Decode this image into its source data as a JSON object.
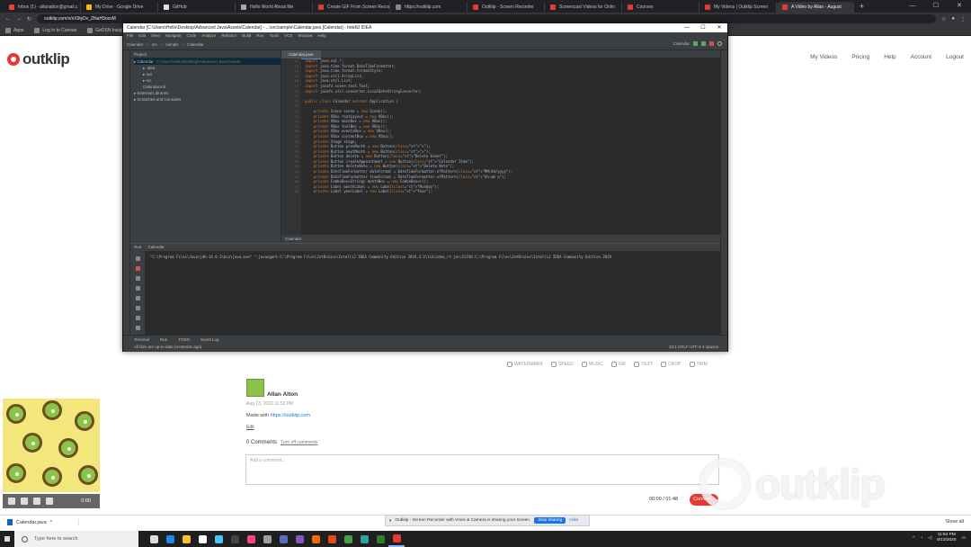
{
  "browser": {
    "tabs": [
      {
        "title": "Inbox (1) - allanalton@gmail.c",
        "color": "#ea4335"
      },
      {
        "title": "My Drive - Google Drive",
        "color": "#fbbc04"
      },
      {
        "title": "GitHub",
        "color": "#e0e0e0"
      },
      {
        "title": "Hello World About Me",
        "color": "#aaaaaa"
      },
      {
        "title": "Create GIF From Screen Recor",
        "color": "#e53935"
      },
      {
        "title": "https://outklip.com",
        "color": "#888888"
      },
      {
        "title": "Outklip - Screen Recorder",
        "color": "#e53935"
      },
      {
        "title": "Screencast Videos for Onlin",
        "color": "#e53935"
      },
      {
        "title": "Courses",
        "color": "#e53935"
      },
      {
        "title": "My Videos | Outklip Screen",
        "color": "#e53935"
      },
      {
        "title": "A Video by Allan - August",
        "color": "#e53935",
        "active": true
      }
    ],
    "new_tab": "+",
    "window_controls": [
      "—",
      "☐",
      "✕"
    ],
    "url": "outklip.com/v/nX9iyDv_ZNaH3oxxM",
    "bookmarks": [
      {
        "label": "Apps"
      },
      {
        "label": "Log In to Canvas"
      },
      {
        "label": "GeDSN Insight Co"
      }
    ]
  },
  "site": {
    "logo_text": "outklip",
    "nav": [
      "My Videos",
      "Pricing",
      "Help",
      "Account",
      "Logout"
    ]
  },
  "ide": {
    "title": "Calendar [C:\\Users\\Hello\\Desktop\\Advanced Java\\Assets\\Calendar] - ...\\src\\sample\\Calendar.java [Calendar] - IntelliJ IDEA",
    "menu": [
      "File",
      "Edit",
      "View",
      "Navigate",
      "Code",
      "Analyze",
      "Refactor",
      "Build",
      "Run",
      "Tools",
      "VCS",
      "Window",
      "Help"
    ],
    "breadcrumbs": [
      "Calendar",
      "src",
      "sample",
      "Calendar"
    ],
    "run_config": "Calendar",
    "project_header": "Project",
    "tree": [
      {
        "label": "Calendar",
        "path": "C:\\Users\\Hello\\Desktop\\Advanced Java\\Assets",
        "selected": true
      },
      {
        "label": ".idea"
      },
      {
        "label": "out"
      },
      {
        "label": "src"
      },
      {
        "label": "Calendar.iml"
      },
      {
        "label": "External Libraries"
      },
      {
        "label": "Scratches and Consoles"
      }
    ],
    "editor_tab": "Calendar.java",
    "code": [
      "import java.sql.*;",
      "import java.time.format.DateTimeFormatter;",
      "import java.time.format.FormatStyle;",
      "import java.util.ArrayList;",
      "import java.util.List;",
      "import javafx.scene.text.Text;",
      "import javafx.util.converter.LocalDateStringConverter;",
      "",
      "public class Calendar extends Application {",
      "",
      "    private Scene scene = new Scene();",
      "    private VBox rootLayout = new VBox();",
      "    private VBox mainBox = new VBox();",
      "    private VBox toolBox = new VBox();",
      "    private VBox eventsBox = new VBox();",
      "    private VBox contentBox = new VBox();",
      "    private Stage stage;",
      "    private Button prevMonth = new Button(\"<\");",
      "    private Button nextMonth = new Button(\">\");",
      "    private Button delete = new Button(\"Delete Event\");",
      "    private Button createAppointment = new Button(\"Calendar Item\");",
      "    private Button deleteNote = new Button(\"Delete Note\");",
      "    private DateTimeFormatter dateFormat = DateTimeFormatter.ofPattern(\"MM/dd/yyyy\");",
      "    private DateTimeFormatter timeFormat = DateTimeFormatter.ofPattern(\"hh:mm a\");",
      "    private ComboBox<String> monthBox = new ComboBox<>();",
      "    private Label monthLabel = new Label(\"Monday\");",
      "    private Label yearLabel = new Label(\"Year\");"
    ],
    "line_start": 12,
    "editor_status": "Calendar",
    "run_tab": "Calendar",
    "run_label": "Run:",
    "run_output": "\"C:\\Program Files\\Java\\jdk-14.0.1\\bin\\java.exe\" \"-javaagent:C:\\Program Files\\JetBrains\\IntelliJ IDEA Community Edition 2019.3.3\\lib\\idea_rt.jar=53746:C:\\Program Files\\JetBrains\\IntelliJ IDEA Community Edition 2019",
    "bottom_tools": [
      "Terminal",
      "Run",
      "TODO",
      "Event Log"
    ],
    "status_left": "All files are up-to-date (moments ago)",
    "status_right": "23:1  CRLF  UTF-8  4 spaces"
  },
  "edit_tools": [
    "WATERMARK",
    "SPEED",
    "MUSIC",
    "GIF",
    "TEXT",
    "CROP",
    "TRIM"
  ],
  "post": {
    "author": "Allan Alton",
    "date": "Aug 13, 2020 11:53 PM",
    "made_with_prefix": "Made with",
    "made_with_link": "https://outklip.com",
    "edit": "Edit",
    "comments_count": "0 Comments",
    "turn_off": "Turn off comments",
    "placeholder": "Add a comment...",
    "timer": "00:00 / 01:48",
    "comment_button": "Comment"
  },
  "watermark": "outklip",
  "camera": {
    "time": "0:00"
  },
  "download": {
    "file": "Calendar.java",
    "show_all": "Show all"
  },
  "share_banner": {
    "text": "Outklip - Screen Recorder with Voice & Camera is sharing your screen.",
    "stop": "Stop sharing",
    "hide": "Hide"
  },
  "taskbar": {
    "search": "Type here to search",
    "time": "11:54 PM",
    "date": "8/13/2020",
    "apps": [
      {
        "name": "task-view-icon",
        "color": "#dddddd"
      },
      {
        "name": "edge-icon",
        "color": "#1e88e5"
      },
      {
        "name": "explorer-icon",
        "color": "#fbc02d"
      },
      {
        "name": "store-icon",
        "color": "#ffffff"
      },
      {
        "name": "mail-icon",
        "color": "#4fc3f7"
      },
      {
        "name": "terminal-icon",
        "color": "#444444"
      },
      {
        "name": "intellij-icon",
        "color": "#ff4081"
      },
      {
        "name": "settings-icon",
        "color": "#9e9e9e"
      },
      {
        "name": "vscode-icon",
        "color": "#5c6bc0"
      },
      {
        "name": "visual-studio-icon",
        "color": "#7e57c2"
      },
      {
        "name": "app-icon",
        "color": "#ef6c00"
      },
      {
        "name": "git-icon",
        "color": "#e64a19"
      },
      {
        "name": "chrome-icon",
        "color": "#43a047"
      },
      {
        "name": "edge-dev-icon",
        "color": "#26a69a"
      },
      {
        "name": "spotify-icon",
        "color": "#2e7d32"
      },
      {
        "name": "outklip-icon",
        "color": "#e53935"
      }
    ]
  }
}
